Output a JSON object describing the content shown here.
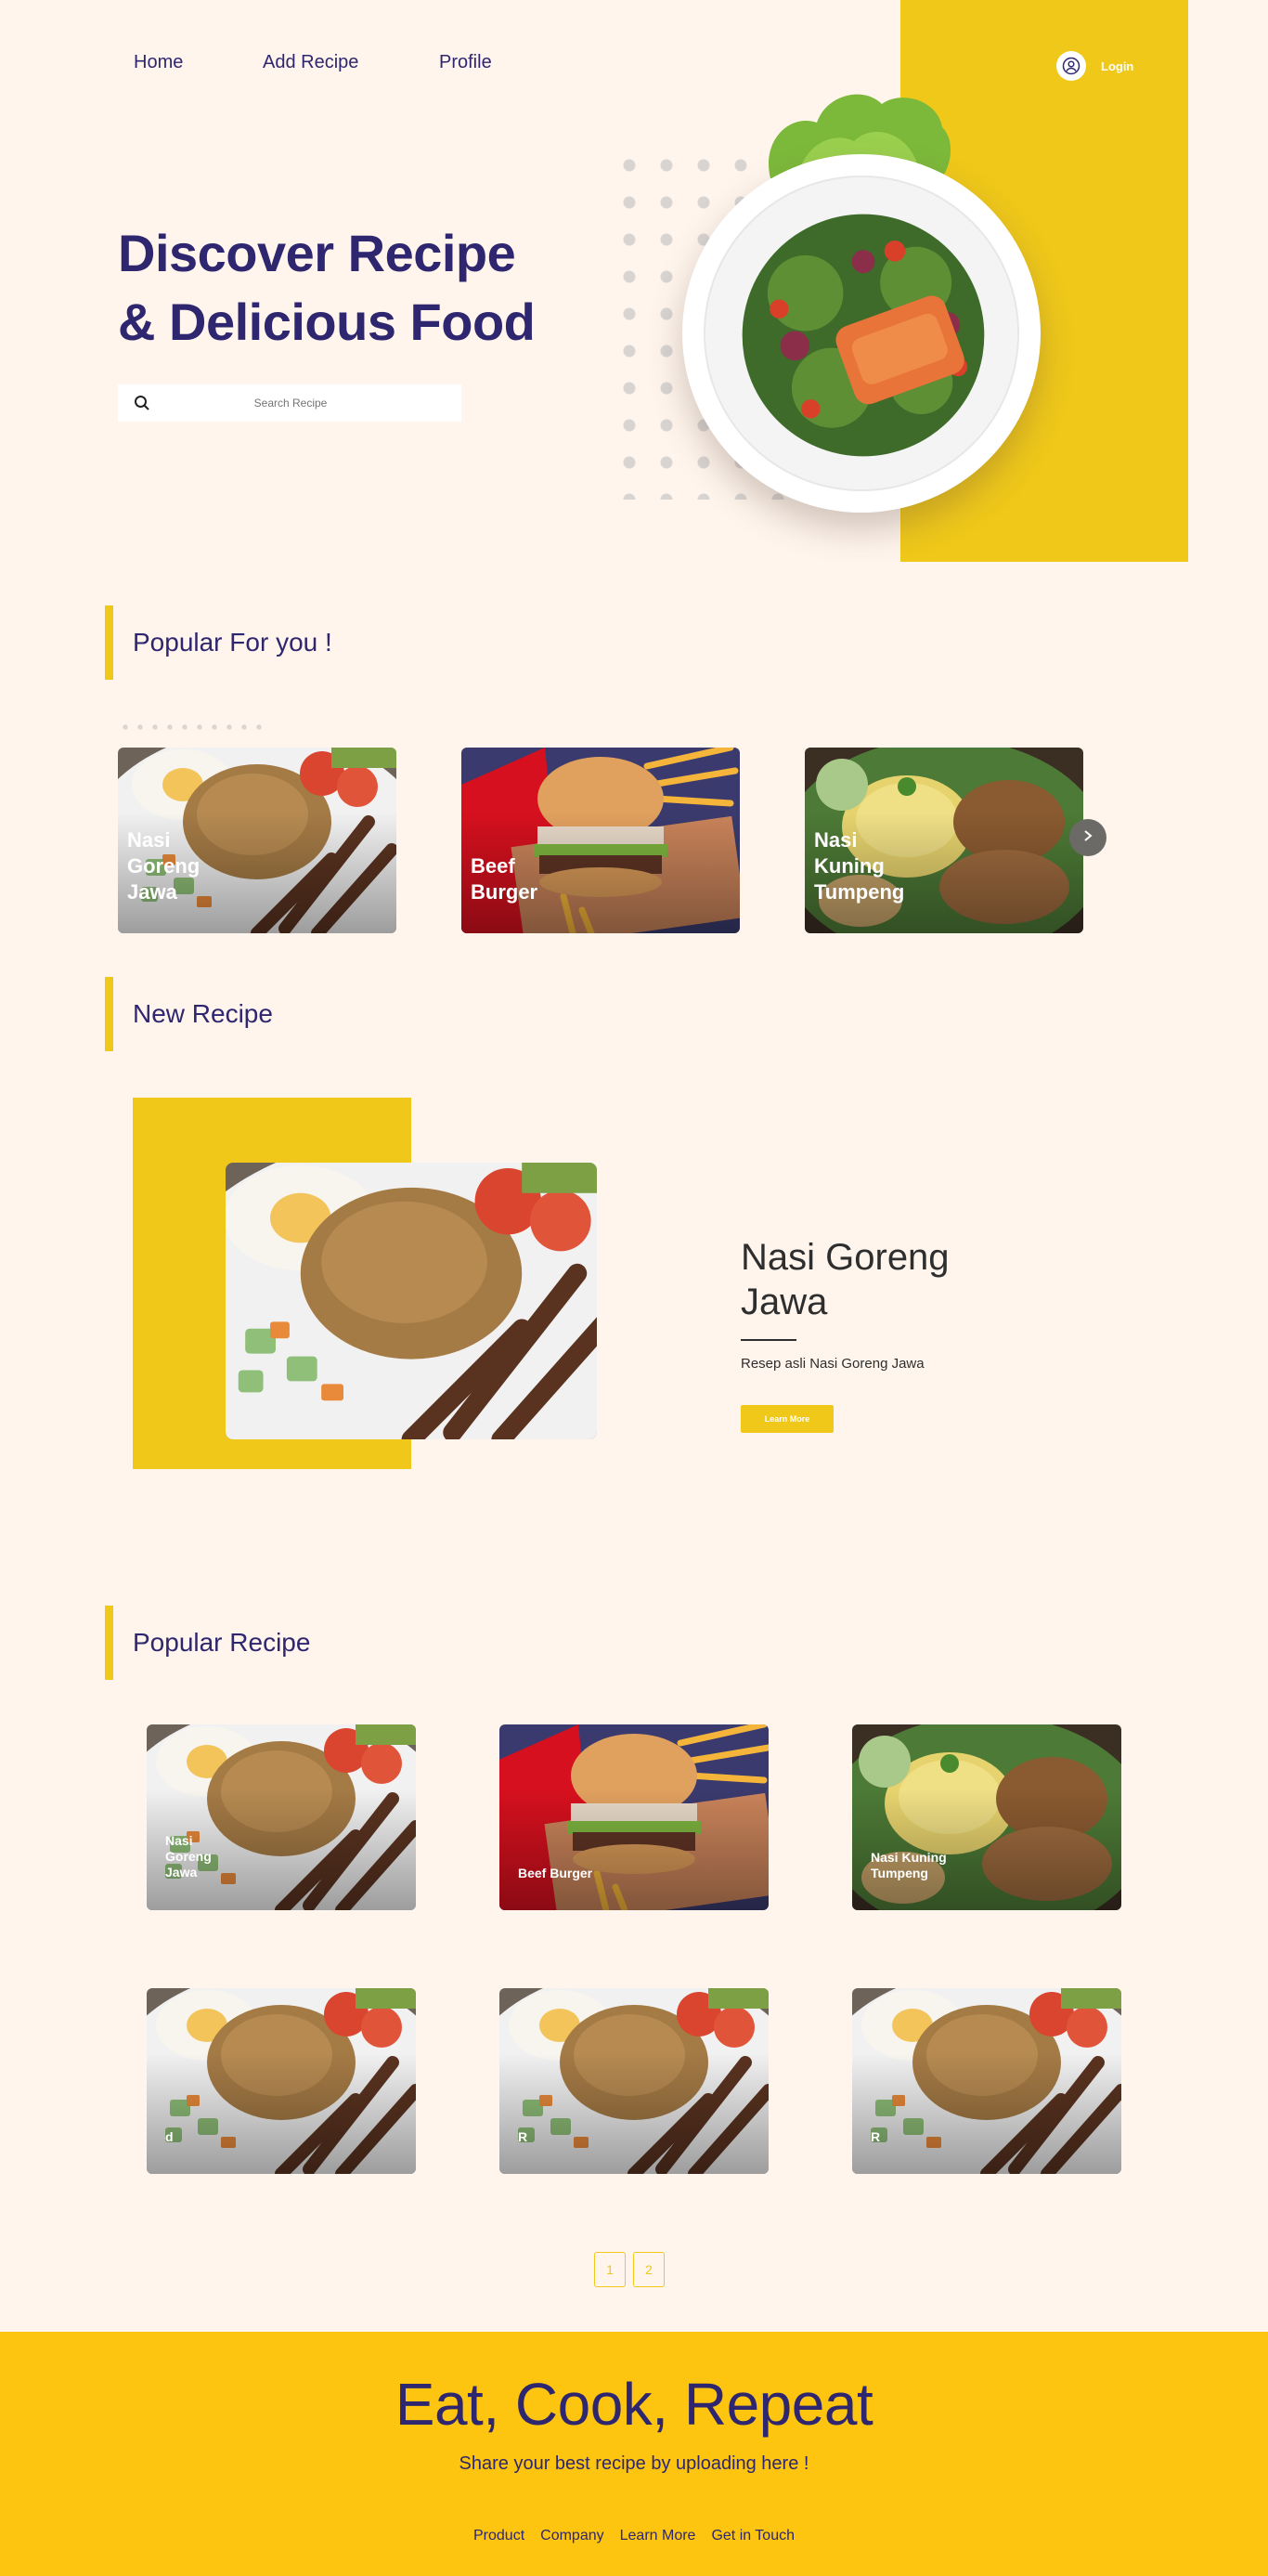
{
  "nav": {
    "links": [
      "Home",
      "Add Recipe",
      "Profile"
    ],
    "login_label": "Login"
  },
  "hero": {
    "title_line1": "Discover Recipe",
    "title_line2": "& Delicious Food",
    "search_placeholder": "Search Recipe"
  },
  "popular_for_you": {
    "title": "Popular For you !",
    "cards": [
      "Nasi Goreng Jawa",
      "Beef Burger",
      "Nasi Kuning Tumpeng"
    ]
  },
  "new_recipe": {
    "section_title": "New Recipe",
    "title": "Nasi Goreng Jawa",
    "description": "Resep asli Nasi Goreng Jawa",
    "button_label": "Learn More"
  },
  "popular_recipe": {
    "title": "Popular Recipe",
    "cards": [
      "Nasi Goreng Jawa",
      "Beef Burger",
      "Nasi Kuning Tumpeng",
      "d",
      "R",
      "R"
    ]
  },
  "pagination": [
    "1",
    "2"
  ],
  "footer": {
    "title": "Eat, Cook, Repeat",
    "subtitle": "Share your best recipe by uploading here !",
    "links": [
      "Product",
      "Company",
      "Learn More",
      "Get in Touch"
    ]
  },
  "colors": {
    "background": "#FFF5EC",
    "accent_yellow": "#EFC81A",
    "footer_yellow": "#FDC50F",
    "navy": "#2E266F"
  }
}
